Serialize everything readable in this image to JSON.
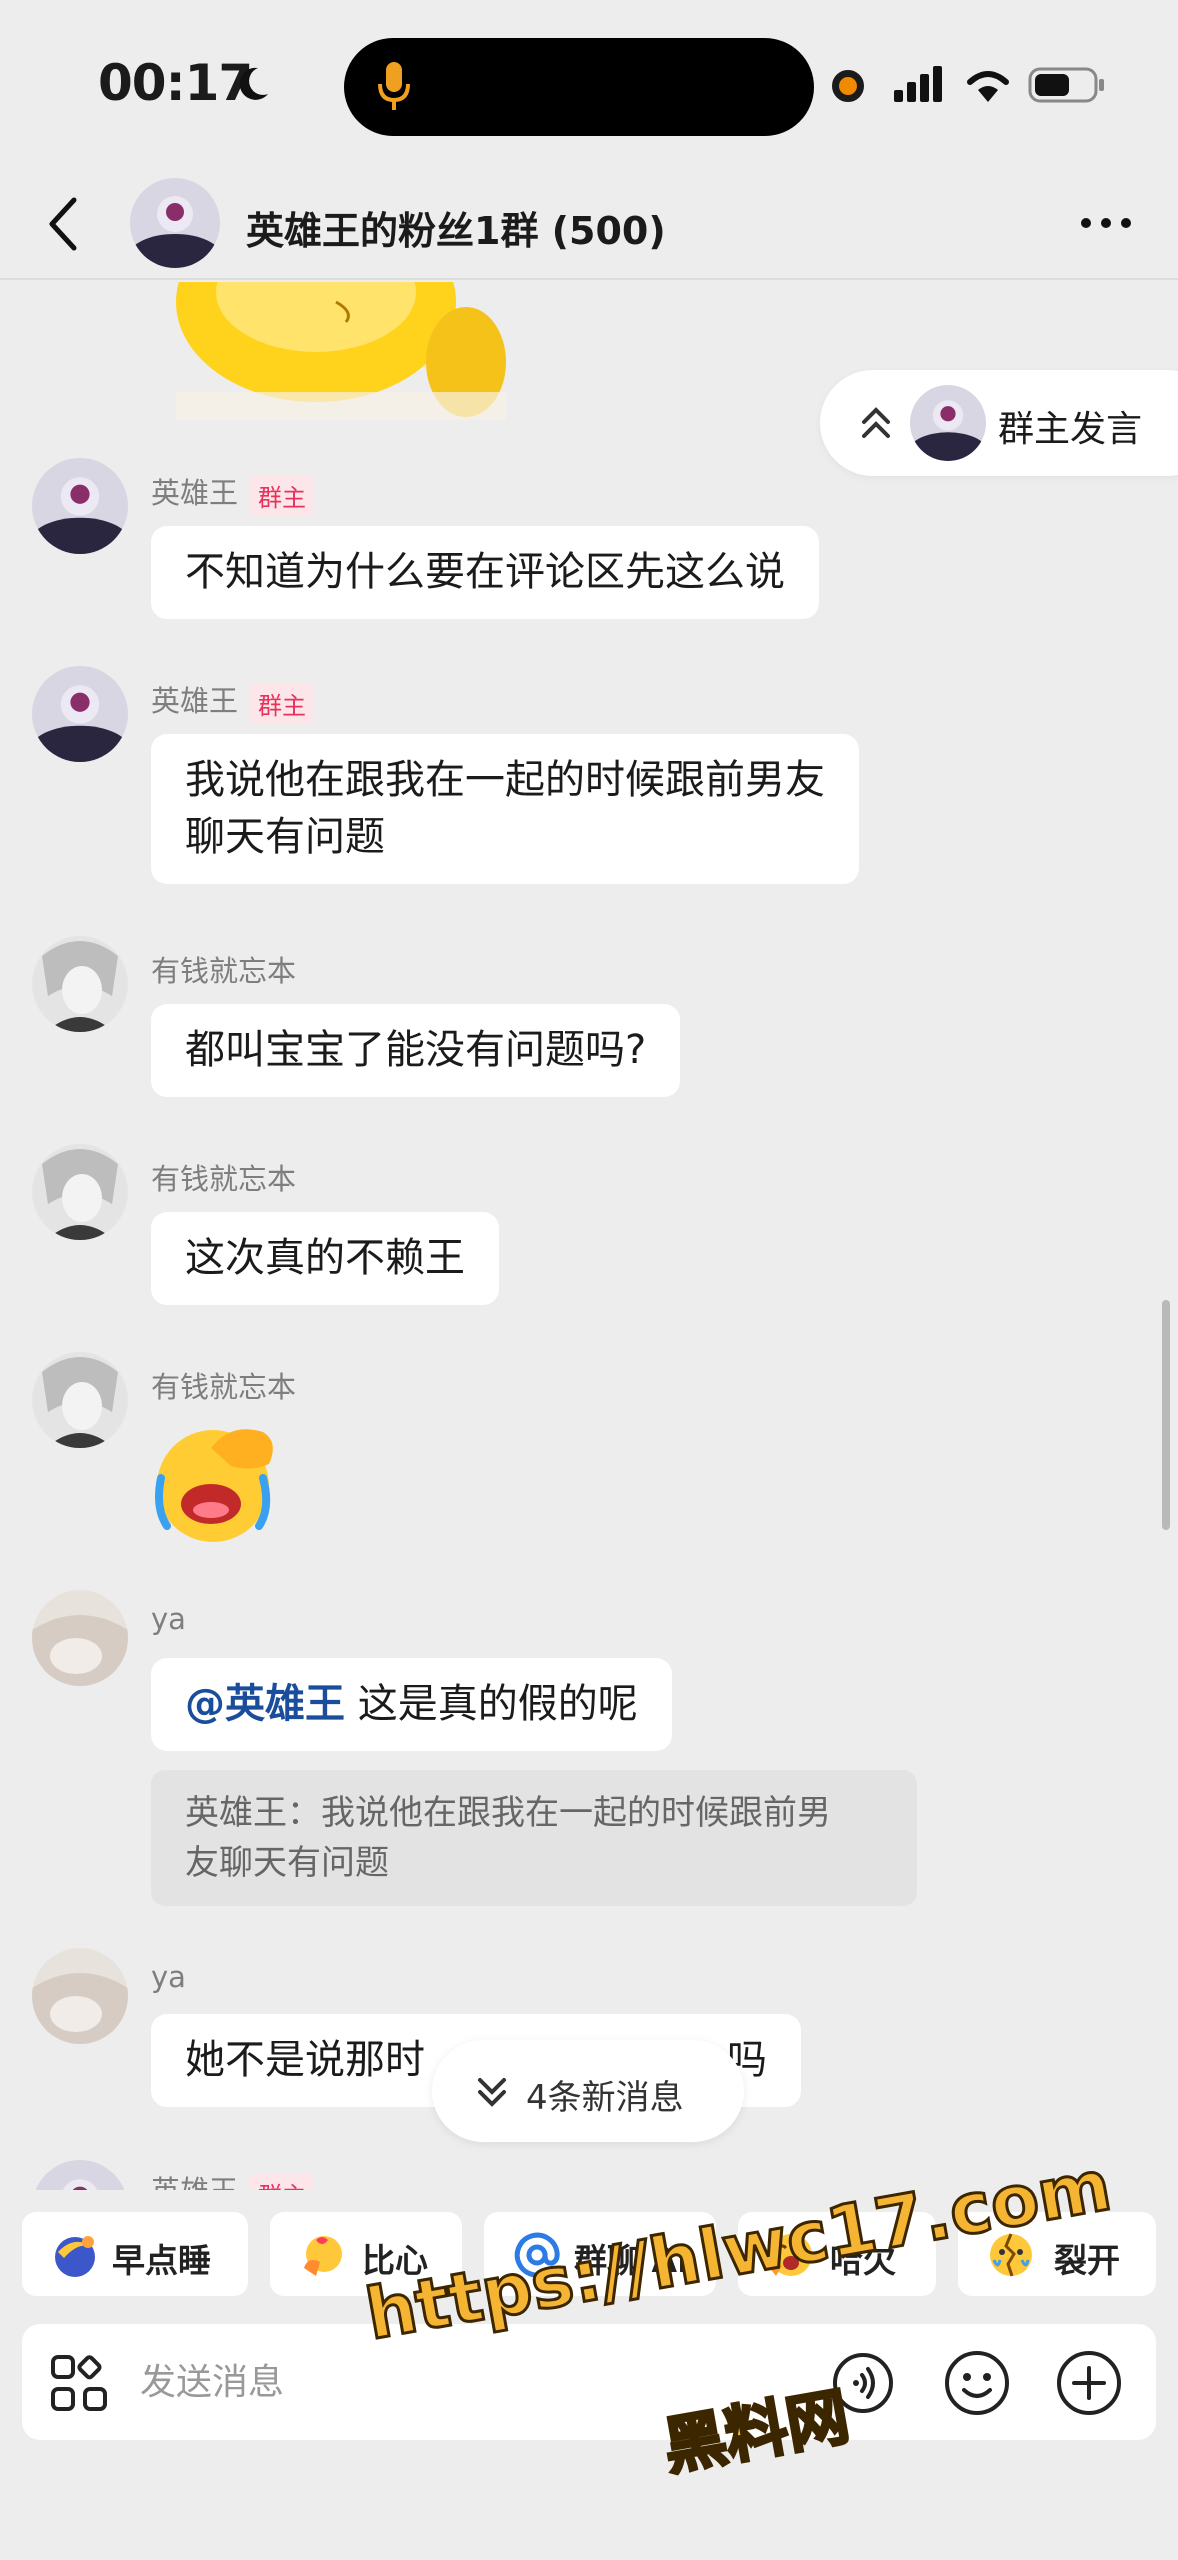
{
  "status_bar": {
    "time": "00:17",
    "icons": [
      "moon-icon",
      "microphone-icon",
      "recording-dot-icon",
      "signal-icon",
      "wifi-icon",
      "battery-icon"
    ]
  },
  "header": {
    "title": "英雄王的粉丝1群 (500)",
    "icons": [
      "back-icon",
      "group-avatar",
      "more-icon"
    ]
  },
  "owner_speak": {
    "label": "群主发言"
  },
  "messages": [
    {
      "sender": "英雄王",
      "badge": "群主",
      "text": "不知道为什么要在评论区先这么说"
    },
    {
      "sender": "英雄王",
      "badge": "群主",
      "lines": [
        "我说他在跟我在一起的时候跟前男友",
        "聊天有问题"
      ]
    },
    {
      "sender": "有钱就忘本",
      "text": "都叫宝宝了能没有问题吗?"
    },
    {
      "sender": "有钱就忘本",
      "text": "这次真的不赖王"
    },
    {
      "sender": "有钱就忘本",
      "emoji": "facepalm-crying-emoji"
    },
    {
      "sender": "ya",
      "mention": "@英雄王",
      "text": " 这是真的假的呢",
      "quote_lines": [
        "英雄王：我说他在跟我在一起的时候跟前男",
        "友聊天有问题"
      ]
    },
    {
      "sender": "ya",
      "text_start": "她不是说那时",
      "text_end": "吗"
    },
    {
      "sender": "英雄王",
      "badge": "群主"
    }
  ],
  "new_messages": {
    "label": "4条新消息"
  },
  "quick_replies": [
    {
      "label": "早点睡",
      "icon": "moon-sleep-icon"
    },
    {
      "label": "比心",
      "icon": "heart-gesture-icon"
    },
    {
      "label": "群聊 AI",
      "icon": "at-sign-icon"
    },
    {
      "label": "哈欠",
      "icon": "yawn-emoji-icon"
    },
    {
      "label": "裂开",
      "icon": "cracked-face-icon"
    }
  ],
  "input": {
    "placeholder": "发送消息"
  },
  "watermark": {
    "url": "https://hlwc17.com",
    "name": "黑料网"
  },
  "colors": {
    "background": "#ededed",
    "bubble": "#ffffff",
    "badge_text": "#e8325d",
    "mention": "#1a4e9c",
    "watermark": "#f5b532"
  }
}
